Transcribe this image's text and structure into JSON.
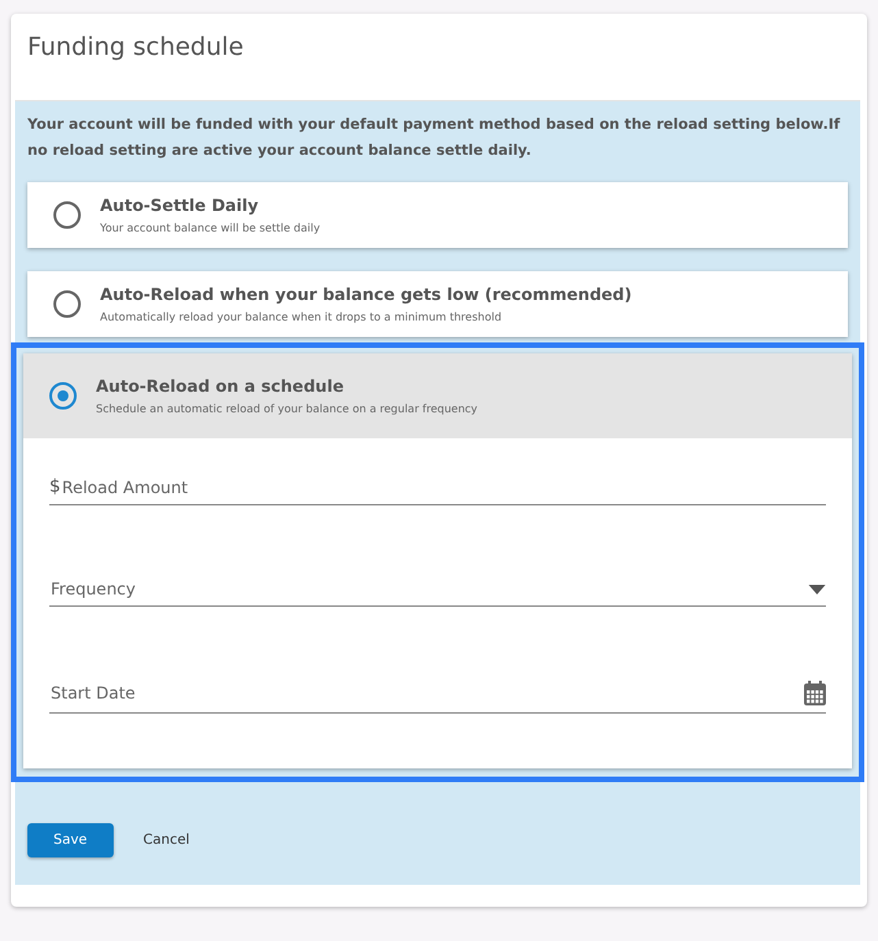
{
  "title": "Funding schedule",
  "intro": "Your account will be funded with your default payment method based on the reload setting below.If no reload setting are active your account balance settle daily.",
  "options": [
    {
      "title": "Auto-Settle Daily",
      "description": "Your account balance will be settle daily",
      "selected": false
    },
    {
      "title": "Auto-Reload when your balance gets low (recommended)",
      "description": "Automatically reload your balance when it drops to a minimum threshold",
      "selected": false
    },
    {
      "title": "Auto-Reload on a schedule",
      "description": "Schedule an automatic reload of your balance on a regular frequency",
      "selected": true,
      "fields": [
        {
          "kind": "amount",
          "prefix": "$",
          "placeholder": "Reload Amount"
        },
        {
          "kind": "select",
          "placeholder": "Frequency"
        },
        {
          "kind": "date",
          "placeholder": "Start Date"
        }
      ]
    }
  ],
  "buttons": [
    {
      "label": "Save",
      "kind": "primary"
    },
    {
      "label": "Cancel",
      "kind": "text"
    }
  ]
}
